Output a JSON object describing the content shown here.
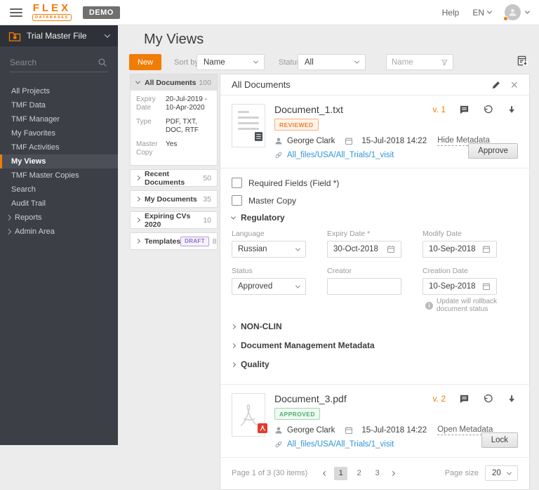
{
  "topbar": {
    "logo_primary": "FLEX",
    "logo_secondary": "DATABASES",
    "demo_badge": "DEMO",
    "help_label": "Help",
    "language": "EN"
  },
  "sidebar": {
    "module_title": "Trial Master File",
    "search_placeholder": "Search",
    "items": [
      {
        "label": "All Projects"
      },
      {
        "label": "TMF Data"
      },
      {
        "label": "TMF Manager"
      },
      {
        "label": "My Favorites"
      },
      {
        "label": "TMF Activities"
      },
      {
        "label": "My Views"
      },
      {
        "label": "TMF Master Copies"
      },
      {
        "label": "Search"
      },
      {
        "label": "Audit Trail"
      },
      {
        "label": "Reports"
      },
      {
        "label": "Admin Area"
      }
    ]
  },
  "page": {
    "title": "My Views"
  },
  "toolbar": {
    "new_button": "New",
    "sort_by_label": "Sort by",
    "sort_value": "Name",
    "status_label": "Status",
    "status_value": "All",
    "filter_placeholder": "Name"
  },
  "views_list": {
    "selected": {
      "label": "All Documents",
      "count": "100",
      "details": [
        {
          "label": "Expiry Date",
          "value": "20-Jul-2019 - 10-Apr-2020"
        },
        {
          "label": "Type",
          "value": "PDF, TXT, DOC, RTF"
        },
        {
          "label": "Master Copy",
          "value": "Yes"
        }
      ]
    },
    "items": [
      {
        "label": "Recent Documents",
        "count": "50"
      },
      {
        "label": "My Documents",
        "count": "35"
      },
      {
        "label": "Expiring CVs 2020",
        "count": "10"
      },
      {
        "label": "Templates",
        "badge": "DRAFT",
        "count": "8"
      }
    ]
  },
  "detail_panel": {
    "title": "All Documents",
    "documents": [
      {
        "name": "Document_1.txt",
        "status_badge": "REVIEWED",
        "author": "George Clark",
        "modified": "15-Jul-2018 14:22",
        "metadata_toggle": "Hide Metadata",
        "path": "All_files/USA/All_Trials/1_visit",
        "version": "v. 1",
        "action_button": "Approve"
      },
      {
        "name": "Document_3.pdf",
        "status_badge": "APPROVED",
        "author": "George Clark",
        "modified": "15-Jul-2018 14:22",
        "metadata_toggle": "Open Metadata",
        "path": "All_files/USA/All_Trials/1_visit",
        "version": "v. 2",
        "action_button": "Lock"
      }
    ],
    "form": {
      "checkbox_required": "Required Fields (Field *)",
      "checkbox_master": "Master Copy",
      "section_regulatory": "Regulatory",
      "fields": {
        "language": {
          "label": "Language",
          "value": "Russian"
        },
        "expiry_date": {
          "label": "Expiry Date *",
          "value": "30-Oct-2018"
        },
        "modify_date": {
          "label": "Modify Date",
          "value": "10-Sep-2018"
        },
        "status": {
          "label": "Status",
          "value": "Approved"
        },
        "creator": {
          "label": "Creator",
          "value": ""
        },
        "creation_date": {
          "label": "Creation Date",
          "value": "10-Sep-2018"
        }
      },
      "note": "Update will rollback document status",
      "collapsed_sections": [
        {
          "label": "NON-CLIN"
        },
        {
          "label": "Document Management Metadata"
        },
        {
          "label": "Quality"
        }
      ]
    },
    "pagination": {
      "summary": "Page 1 of 3  (30 items)",
      "pages": [
        {
          "label": "1"
        },
        {
          "label": "2"
        },
        {
          "label": "3"
        }
      ],
      "page_size_label": "Page size",
      "page_size_value": "20"
    }
  },
  "colors": {
    "accent_orange": "#F07D05",
    "link_blue": "#2F95D8",
    "status_reviewed": "#EF8030",
    "status_approved": "#4FAE70",
    "badge_draft": "#8D6FC4",
    "sidebar_bg": "#3C3F45"
  }
}
